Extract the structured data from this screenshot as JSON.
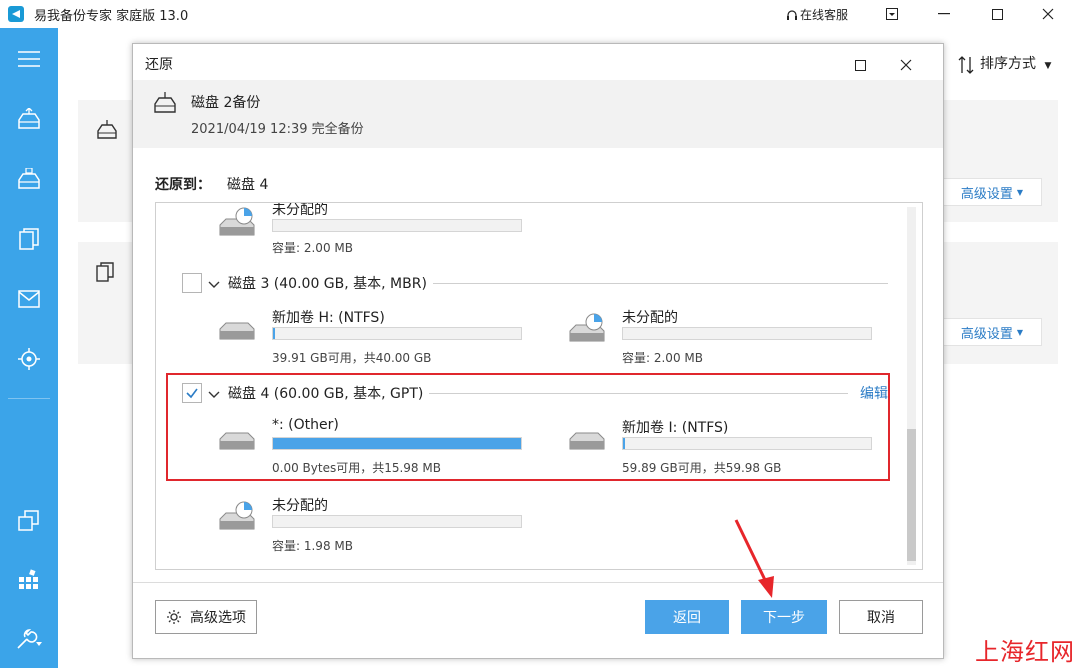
{
  "app": {
    "title": "易我备份专家 家庭版 13.0",
    "online_service": "在线客服"
  },
  "window_controls": {
    "menu": "⊡",
    "minimize": "—",
    "maximize": "☐",
    "close": "✕"
  },
  "main": {
    "sort_label": "排序方式",
    "advanced_settings_1": "高级设置",
    "advanced_settings_2": "高级设置"
  },
  "dialog": {
    "title": "还原",
    "backup_name": "磁盘 2备份",
    "backup_date": "2021/04/19 12:39 完全备份",
    "restore_to_label": "还原到：",
    "restore_target": "磁盘 4",
    "top_partition": {
      "name": "未分配的",
      "info": "容量: 2.00 MB",
      "fill": 0
    },
    "disk3": {
      "label": "磁盘 3 (40.00 GB, 基本, MBR)",
      "partitions": [
        {
          "name": "新加卷 H: (NTFS)",
          "info": "39.91 GB可用，共40.00 GB",
          "fill": 0.01
        },
        {
          "name": "未分配的",
          "info": "容量: 2.00 MB",
          "fill": 0
        }
      ]
    },
    "disk4": {
      "label": "磁盘 4 (60.00 GB, 基本, GPT)",
      "edit": "编辑",
      "checked": true,
      "partitions": [
        {
          "name": "*: (Other)",
          "info": "0.00 Bytes可用，共15.98 MB",
          "fill": 1.0
        },
        {
          "name": "新加卷 I: (NTFS)",
          "info": "59.89 GB可用，共59.98 GB",
          "fill": 0.01
        }
      ]
    },
    "bottom_partition": {
      "name": "未分配的",
      "info": "容量: 1.98 MB",
      "fill": 0
    },
    "buttons": {
      "advanced_options": "高级选项",
      "back": "返回",
      "next": "下一步",
      "cancel": "取消"
    }
  },
  "watermark": "上海红网",
  "colors": {
    "sidebar": "#3ba4e9",
    "accent": "#4aa3e8",
    "highlight_border": "#e0272d",
    "annotation_arrow": "#e7262b"
  }
}
